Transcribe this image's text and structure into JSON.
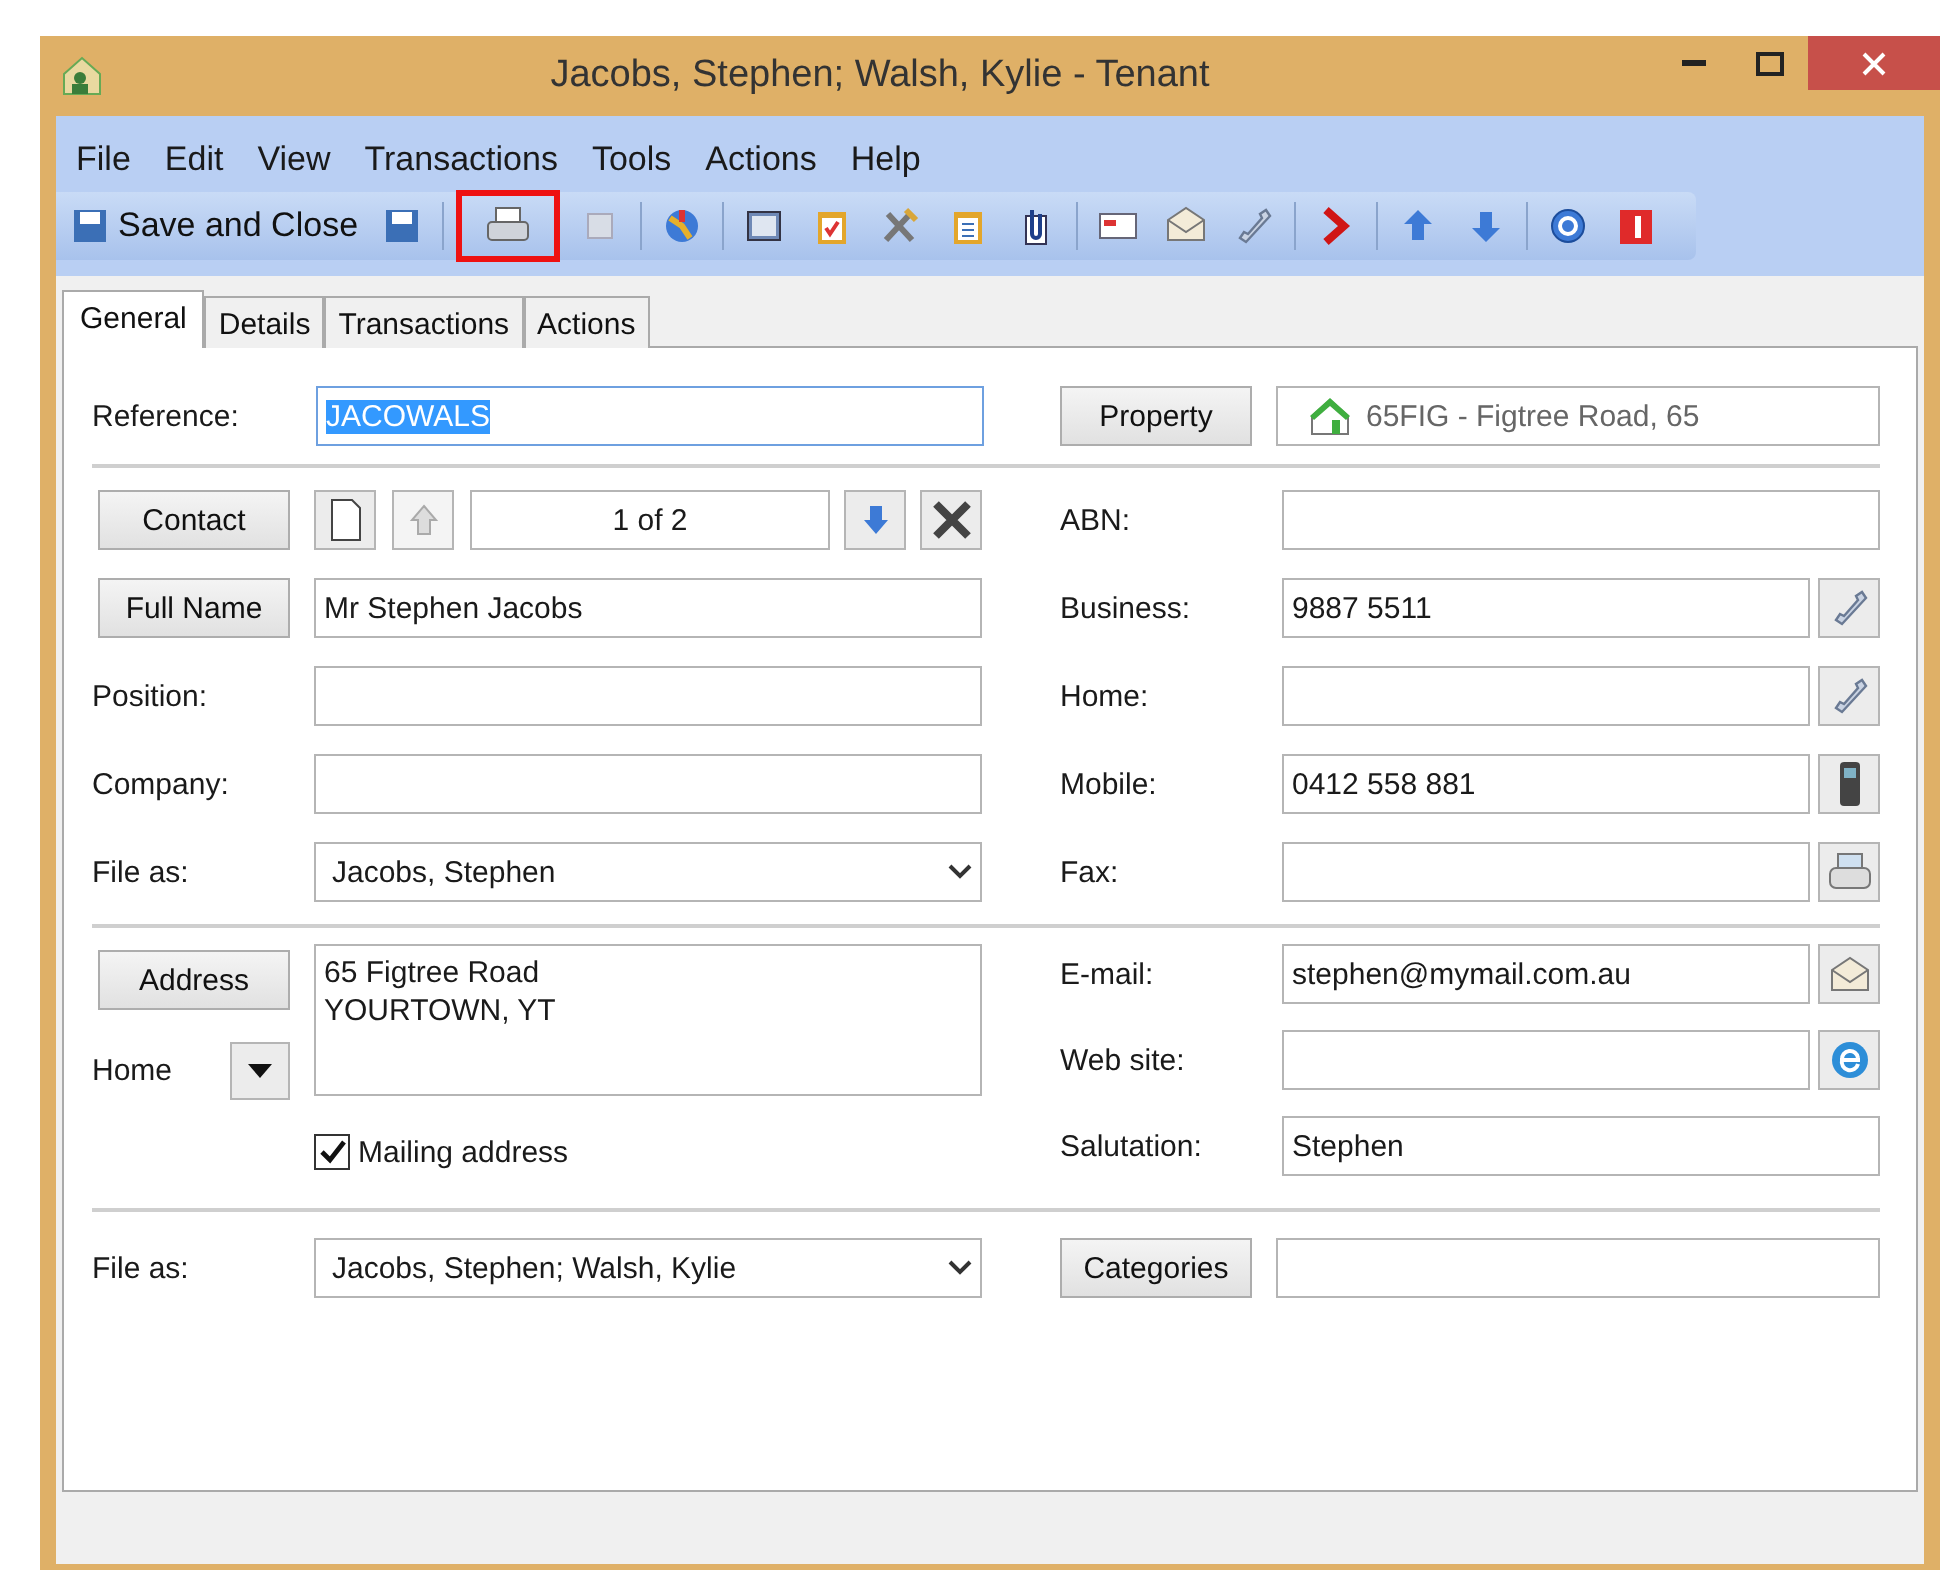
{
  "window": {
    "title": "Jacobs, Stephen; Walsh, Kylie - Tenant"
  },
  "menu": [
    "File",
    "Edit",
    "View",
    "Transactions",
    "Tools",
    "Actions",
    "Help"
  ],
  "toolbar": {
    "save_close": "Save and Close",
    "print_highlighted": true
  },
  "tabs": [
    {
      "label": "General",
      "selected": true
    },
    {
      "label": "Details",
      "selected": false
    },
    {
      "label": "Transactions",
      "selected": false
    },
    {
      "label": "Actions",
      "selected": false
    }
  ],
  "reference": {
    "label": "Reference:",
    "value": "JACOWALS",
    "value_selected": true
  },
  "property": {
    "button": "Property",
    "value": "65FIG - Figtree Road, 65"
  },
  "contact": {
    "button": "Contact",
    "counter": "1 of 2"
  },
  "left_rows": [
    {
      "kind": "button",
      "label": "Full Name",
      "value": "Mr Stephen Jacobs"
    },
    {
      "kind": "text",
      "label": "Position:"
    },
    {
      "kind": "text",
      "label": "Company:"
    },
    {
      "kind": "select",
      "label": "File as:",
      "value": "Jacobs, Stephen"
    }
  ],
  "right_rows": [
    {
      "kind": "plain",
      "label": "ABN:"
    },
    {
      "kind": "phone",
      "label": "Business:",
      "value": "9887 5511"
    },
    {
      "kind": "phone",
      "label": "Home:"
    },
    {
      "kind": "mobile",
      "label": "Mobile:",
      "value": "0412 558 881"
    },
    {
      "kind": "fax",
      "label": "Fax:"
    }
  ],
  "address": {
    "button": "Address",
    "type": "Home",
    "lines": "65 Figtree Road\nYOURTOWN, YT",
    "mailing_label": "Mailing address",
    "mailing_checked": true
  },
  "address_right": [
    {
      "kind": "email",
      "label": "E-mail:",
      "value": "stephen@mymail.com.au"
    },
    {
      "kind": "web",
      "label": "Web site:"
    },
    {
      "kind": "plain",
      "label": "Salutation:",
      "value": "Stephen"
    }
  ],
  "footer": {
    "label": "File as:",
    "value": "Jacobs, Stephen; Walsh, Kylie",
    "categories_button": "Categories"
  }
}
